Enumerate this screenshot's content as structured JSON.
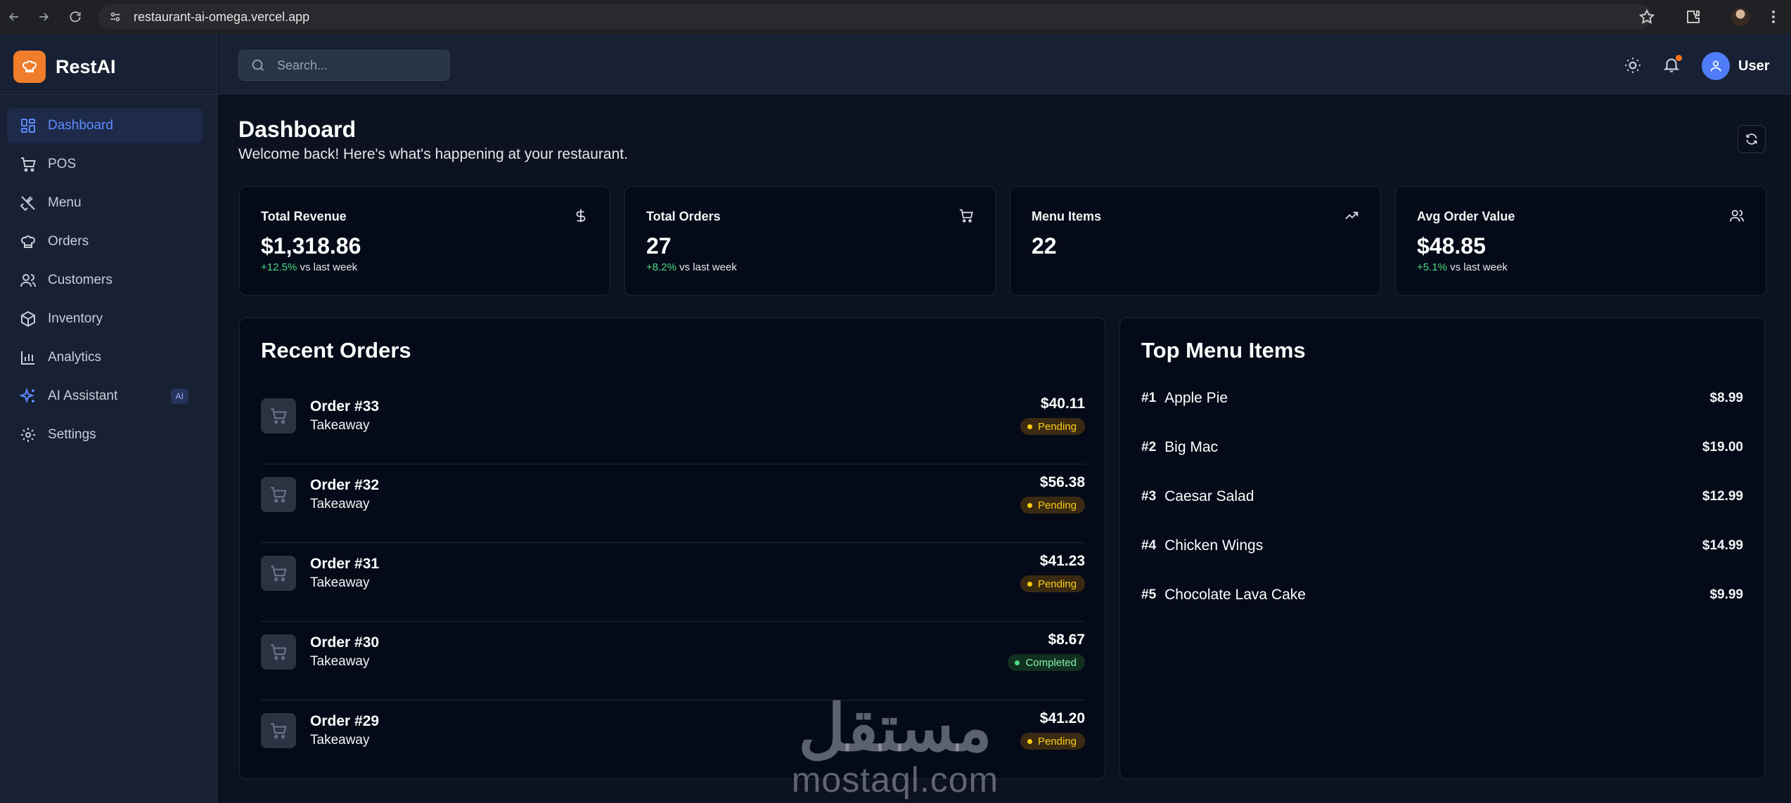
{
  "browser": {
    "url": "restaurant-ai-omega.vercel.app"
  },
  "sidebar": {
    "brand": "RestAI",
    "items": [
      {
        "label": "Dashboard",
        "icon": "dashboard-icon",
        "active": true
      },
      {
        "label": "POS",
        "icon": "cart-icon"
      },
      {
        "label": "Menu",
        "icon": "utensils-icon"
      },
      {
        "label": "Orders",
        "icon": "chef-hat-icon"
      },
      {
        "label": "Customers",
        "icon": "users-icon"
      },
      {
        "label": "Inventory",
        "icon": "package-icon"
      },
      {
        "label": "Analytics",
        "icon": "bar-chart-icon"
      },
      {
        "label": "AI Assistant",
        "icon": "sparkles-icon",
        "badge": "AI"
      },
      {
        "label": "Settings",
        "icon": "gear-icon"
      }
    ]
  },
  "header": {
    "search_placeholder": "Search...",
    "user_name": "User"
  },
  "main": {
    "title": "Dashboard",
    "subtitle": "Welcome back! Here's what's happening at your restaurant."
  },
  "stats": [
    {
      "title": "Total Revenue",
      "value": "$1,318.86",
      "delta": "+12.5%",
      "delta_suffix": " vs last week",
      "icon": "dollar-icon"
    },
    {
      "title": "Total Orders",
      "value": "27",
      "delta": "+8.2%",
      "delta_suffix": " vs last week",
      "icon": "cart-icon"
    },
    {
      "title": "Menu Items",
      "value": "22",
      "delta": "",
      "delta_suffix": "",
      "icon": "trending-up-icon"
    },
    {
      "title": "Avg Order Value",
      "value": "$48.85",
      "delta": "+5.1%",
      "delta_suffix": " vs last week",
      "icon": "users-icon"
    }
  ],
  "recent_orders": {
    "title": "Recent Orders",
    "orders": [
      {
        "name": "Order #33",
        "type": "Takeaway",
        "total": "$40.11",
        "status": "Pending"
      },
      {
        "name": "Order #32",
        "type": "Takeaway",
        "total": "$56.38",
        "status": "Pending"
      },
      {
        "name": "Order #31",
        "type": "Takeaway",
        "total": "$41.23",
        "status": "Pending"
      },
      {
        "name": "Order #30",
        "type": "Takeaway",
        "total": "$8.67",
        "status": "Completed"
      },
      {
        "name": "Order #29",
        "type": "Takeaway",
        "total": "$41.20",
        "status": "Pending"
      }
    ]
  },
  "top_menu": {
    "title": "Top Menu Items",
    "items": [
      {
        "rank": "#1",
        "name": "Apple Pie",
        "price": "$8.99"
      },
      {
        "rank": "#2",
        "name": "Big Mac",
        "price": "$19.00"
      },
      {
        "rank": "#3",
        "name": "Caesar Salad",
        "price": "$12.99"
      },
      {
        "rank": "#4",
        "name": "Chicken Wings",
        "price": "$14.99"
      },
      {
        "rank": "#5",
        "name": "Chocolate Lava Cake",
        "price": "$9.99"
      }
    ]
  },
  "watermark": {
    "arabic": "مستقل",
    "latin": "mostaql.com"
  },
  "colors": {
    "accent": "#5b8cff",
    "brand": "#ef7d2a",
    "positive": "#4ade80",
    "pending": "#facc15"
  }
}
